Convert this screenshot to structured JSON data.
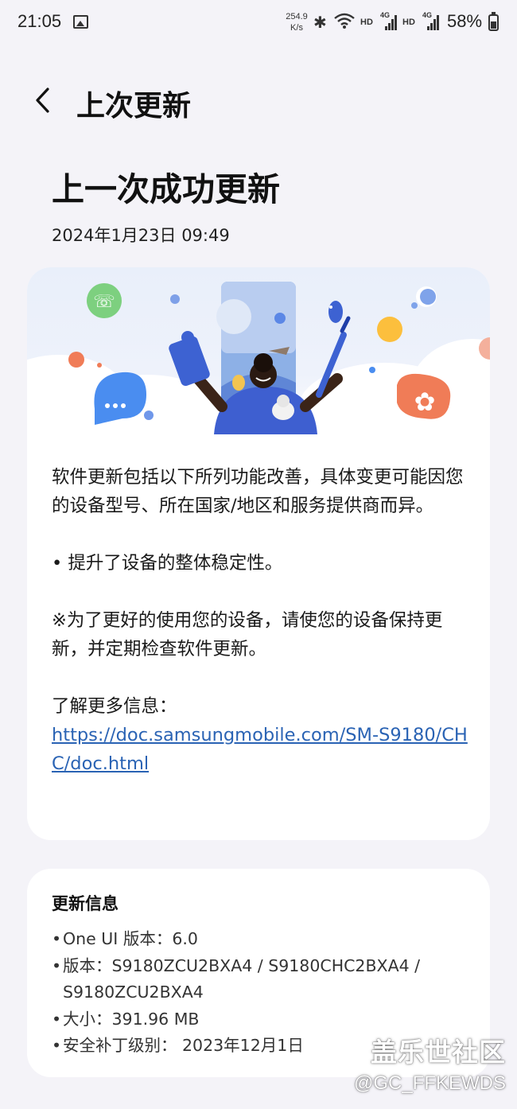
{
  "status_bar": {
    "time": "21:05",
    "net_speed_value": "254.9",
    "net_speed_unit": "K/s",
    "hd1": "HD",
    "lte1": "4G",
    "hd2": "HD",
    "lte2": "4G",
    "battery": "58%"
  },
  "header": {
    "title": "上次更新"
  },
  "main": {
    "title": "上一次成功更新",
    "date": "2024年1月23日 09:49",
    "description": "软件更新包括以下所列功能改善，具体变更可能因您的设备型号、所在国家/地区和服务提供商而异。",
    "bullet": "• 提升了设备的整体稳定性。",
    "note": "※为了更好的使用您的设备，请使您的设备保持更新，并定期检查软件更新。",
    "more_info_label": "了解更多信息：",
    "link": "https://doc.samsungmobile.com/SM-S9180/CHC/doc.html"
  },
  "info": {
    "title": "更新信息",
    "items": [
      "One UI 版本：6.0",
      "版本：S9180ZCU2BXA4 / S9180CHC2BXA4 / S9180ZCU2BXA4",
      "大小：391.96 MB",
      "安全补丁级别： 2023年12月1日"
    ]
  },
  "watermark": {
    "line1": "盖乐世社区",
    "line2": "@GC_FFKEWDS"
  },
  "colors": {
    "background": "#f4f3f8",
    "card": "#ffffff",
    "link": "#2a63b4"
  },
  "icons": [
    "back-arrow-icon",
    "photo-icon",
    "bluetooth-icon",
    "wifi-icon",
    "signal-icon",
    "battery-icon"
  ]
}
